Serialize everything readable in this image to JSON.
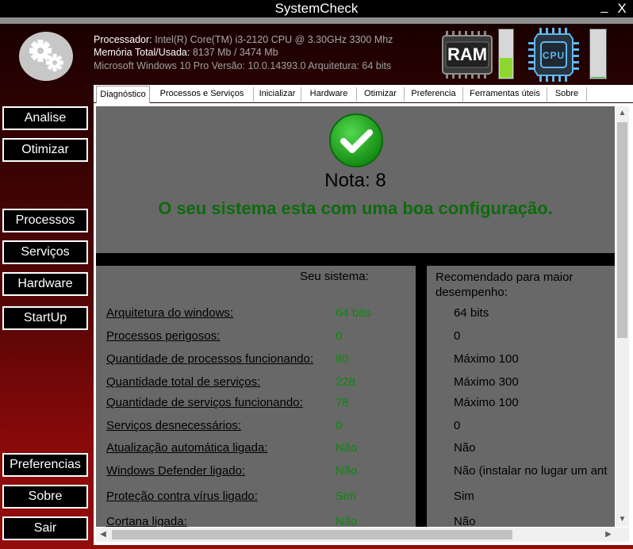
{
  "window": {
    "title": "SystemCheck",
    "minimize": "_",
    "close": "X"
  },
  "header": {
    "processor_label": "Processador:",
    "processor_value": "Intel(R) Core(TM) i3-2120 CPU @ 3.30GHz 3300 Mhz",
    "memory_label": "Memória Total/Usada:",
    "memory_value": "8137 Mb  / 3474 Mb",
    "os_line": "Microsoft Windows 10 Pro Versão: 10.0.14393.0 Arquitetura: 64 bits",
    "ram_label": "RAM",
    "cpu_label": "CPU",
    "ram_usage_fraction": 0.43,
    "cpu_usage_fraction": 0.05,
    "colors": {
      "ram_meter": "#8ed62e",
      "cpu_meter": "#1cae2c"
    }
  },
  "sidebar": {
    "analise": "Analise",
    "otimizar": "Otimizar",
    "processos": "Processos",
    "servicos": "Serviços",
    "hardware": "Hardware",
    "startup": "StartUp",
    "preferencias": "Preferencias",
    "sobre": "Sobre",
    "sair": "Sair"
  },
  "tabs": [
    {
      "label": "Diagnóstico",
      "active": true
    },
    {
      "label": "Processos e Serviços"
    },
    {
      "label": "Inicializar"
    },
    {
      "label": "Hardware"
    },
    {
      "label": "Otimizar"
    },
    {
      "label": "Preferencia"
    },
    {
      "label": "Ferramentas úteis"
    },
    {
      "label": "Sobre"
    }
  ],
  "diagnostic": {
    "status_icon": "check-icon",
    "grade": "Nota: 8",
    "status_message": "O seu sistema esta com uma boa configuração.",
    "column_yours": "Seu sistema:",
    "column_recommended": "Recomendado para maior desempenho:",
    "rows": [
      {
        "label": "Arquitetura do windows:",
        "value": "64 bits",
        "recommended": "64 bits"
      },
      {
        "label": "Processos perigosos:",
        "value": "0",
        "recommended": "0"
      },
      {
        "label": "Quantidade de processos funcionando:",
        "value": "80",
        "recommended": "Máximo 100"
      },
      {
        "label": "Quantidade total de serviços:",
        "value": "228",
        "recommended": "Máximo 300"
      },
      {
        "label": "Quantidade de serviços funcionando:",
        "value": "78",
        "recommended": "Máximo 100"
      },
      {
        "label": "Serviços desnecessários:",
        "value": "0",
        "recommended": "0"
      },
      {
        "label": "Atualização automática ligada:",
        "value": "Não",
        "recommended": "Não"
      },
      {
        "label": "Windows Defender ligado:",
        "value": "Não",
        "recommended": "Não (instalar no lugar um ant"
      },
      {
        "label": "Proteção contra vírus ligado:",
        "value": "Sim",
        "recommended": "Sim"
      },
      {
        "label": "Cortana ligada:",
        "value": "Não",
        "recommended": "Não"
      }
    ],
    "colors": {
      "status": "#0d6b0d",
      "value": "#0a8a0a",
      "panel": "#686868"
    }
  }
}
